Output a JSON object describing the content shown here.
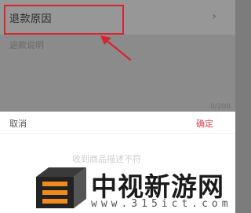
{
  "form": {
    "reason_label": "退款原因",
    "chevron_glyph": "›",
    "description_placeholder": "退款说明",
    "char_counter": "0/200"
  },
  "picker": {
    "cancel_label": "取消",
    "confirm_label": "确定",
    "option_faded": "收到商品描述不符"
  },
  "annotation": {
    "highlight_color": "#d6252f"
  },
  "watermark": {
    "text": "中视新游网",
    "url": "www.315ict.com"
  }
}
